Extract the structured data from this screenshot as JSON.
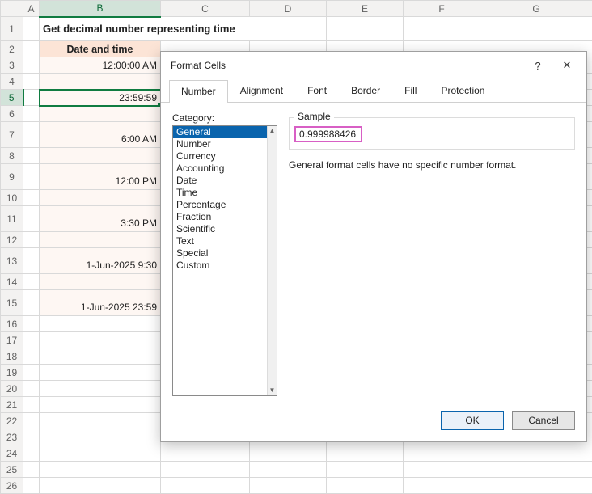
{
  "columns": [
    "A",
    "B",
    "C",
    "D",
    "E",
    "F",
    "G"
  ],
  "rows": [
    "1",
    "2",
    "3",
    "4",
    "5",
    "6",
    "7",
    "8",
    "9",
    "10",
    "11",
    "12",
    "13",
    "14",
    "15",
    "16",
    "17",
    "18",
    "19",
    "20",
    "21",
    "22",
    "23",
    "24",
    "25",
    "26"
  ],
  "selected_col": "B",
  "selected_row": "5",
  "title_cell": "Get decimal number representing time",
  "table_header": "Date and time",
  "data": {
    "r3": "12:00:00 AM",
    "r5": "23:59:59",
    "r7": "6:00 AM",
    "r9": "12:00 PM",
    "r11": "3:30 PM",
    "r13": "1-Jun-2025 9:30",
    "r15": "1-Jun-2025 23:59"
  },
  "dialog": {
    "title": "Format Cells",
    "help": "?",
    "close": "✕",
    "tabs": [
      "Number",
      "Alignment",
      "Font",
      "Border",
      "Fill",
      "Protection"
    ],
    "active_tab": "Number",
    "category_label": "Category:",
    "categories": [
      "General",
      "Number",
      "Currency",
      "Accounting",
      "Date",
      "Time",
      "Percentage",
      "Fraction",
      "Scientific",
      "Text",
      "Special",
      "Custom"
    ],
    "selected_category": "General",
    "sample_label": "Sample",
    "sample_value": "0.999988426",
    "description": "General format cells have no specific number format.",
    "ok": "OK",
    "cancel": "Cancel"
  }
}
